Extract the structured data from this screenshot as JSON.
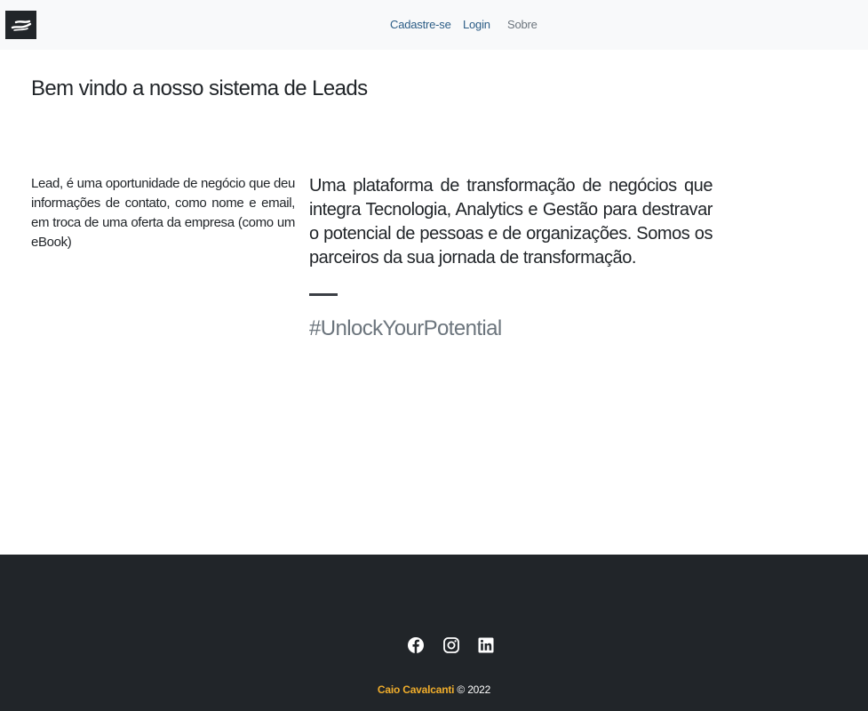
{
  "navbar": {
    "logo_icon": "handshake-logo-icon",
    "links": [
      {
        "label": "Cadastre-se"
      },
      {
        "label": "Login"
      },
      {
        "label": "Sobre"
      }
    ]
  },
  "main": {
    "title": "Bem vindo a nosso sistema de Leads",
    "lead_definition": "Lead, é uma oportunidade de negócio que deu informações de contato, como nome e email, em troca de uma oferta da empresa (como um eBook)",
    "platform_text": "Uma plataforma de transformação de negócios que integra Tecnologia, Analytics e Gestão para destravar o potencial de pessoas e de organizações. Somos os parceiros da sua jornada de transformação.",
    "hashtag": "#UnlockYourPotential"
  },
  "footer": {
    "social_icons": [
      "facebook-icon",
      "instagram-icon",
      "linkedin-icon"
    ],
    "author": "Caio Cavalcanti",
    "copyright": "© 2022"
  },
  "colors": {
    "navbar_bg": "#f8f9fa",
    "footer_bg": "#212529",
    "link_primary": "#2c5d86",
    "link_muted": "#6c757d",
    "author_accent": "#f0ad2b"
  }
}
